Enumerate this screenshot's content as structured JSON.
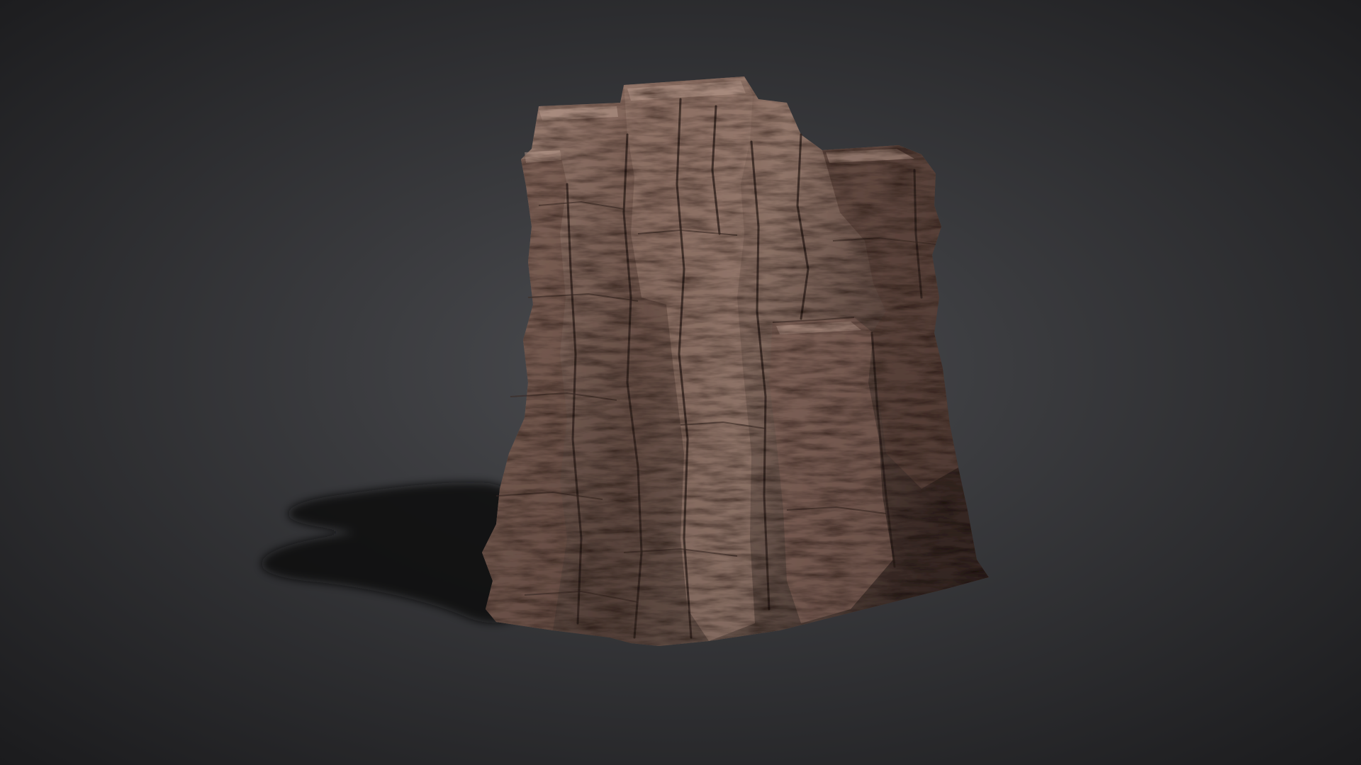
{
  "scene": {
    "subject_icon": "rock-pillar-icon",
    "colors": {
      "background_center": "#4b4c50",
      "background_edge": "#1b1b1d",
      "rock_light": "#a88b7e",
      "rock_mid": "#7a5d52",
      "rock_dark": "#3e2c27",
      "shadow": "#0e0e10"
    }
  }
}
